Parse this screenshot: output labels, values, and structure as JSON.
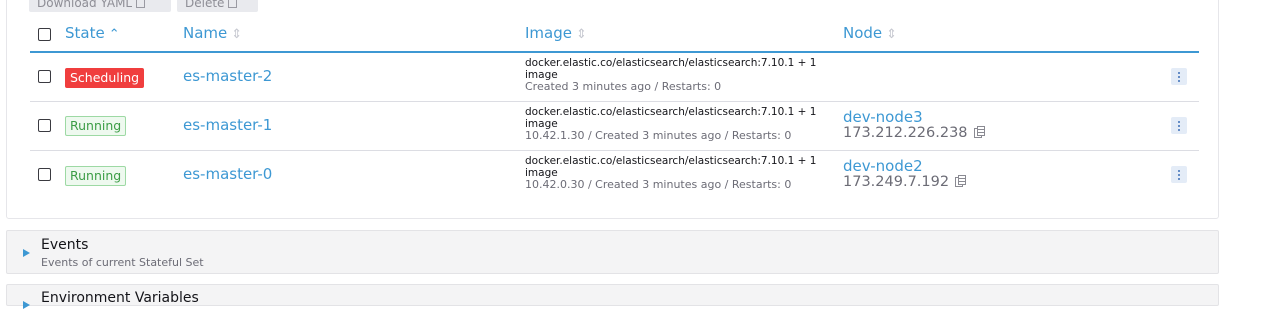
{
  "toolbar": {
    "download_label": "Download YAML",
    "delete_label": "Delete"
  },
  "table": {
    "headers": {
      "state": "State",
      "name": "Name",
      "image": "Image",
      "node": "Node"
    },
    "rows": [
      {
        "state": "Scheduling",
        "name": "es-master-2",
        "image": "docker.elastic.co/elasticsearch/elasticsearch:7.10.1 + 1",
        "image_suffix": "image",
        "meta": "Created 3 minutes ago / Restarts: 0",
        "node": "",
        "ip": ""
      },
      {
        "state": "Running",
        "name": "es-master-1",
        "image": "docker.elastic.co/elasticsearch/elasticsearch:7.10.1 + 1",
        "image_suffix": "image",
        "meta": "10.42.1.30 / Created 3 minutes ago / Restarts: 0",
        "node": "dev-node3",
        "ip": "173.212.226.238"
      },
      {
        "state": "Running",
        "name": "es-master-0",
        "image": "docker.elastic.co/elasticsearch/elasticsearch:7.10.1 + 1",
        "image_suffix": "image",
        "meta": "10.42.0.30 / Created 3 minutes ago / Restarts: 0",
        "node": "dev-node2",
        "ip": "173.249.7.192"
      }
    ]
  },
  "sections": {
    "events": {
      "title": "Events",
      "subtitle": "Events of current Stateful Set"
    },
    "env": {
      "title": "Environment Variables"
    }
  },
  "colors": {
    "accent": "#3d98d3",
    "scheduling": "#f03e3e",
    "running": "#3c9d46"
  }
}
